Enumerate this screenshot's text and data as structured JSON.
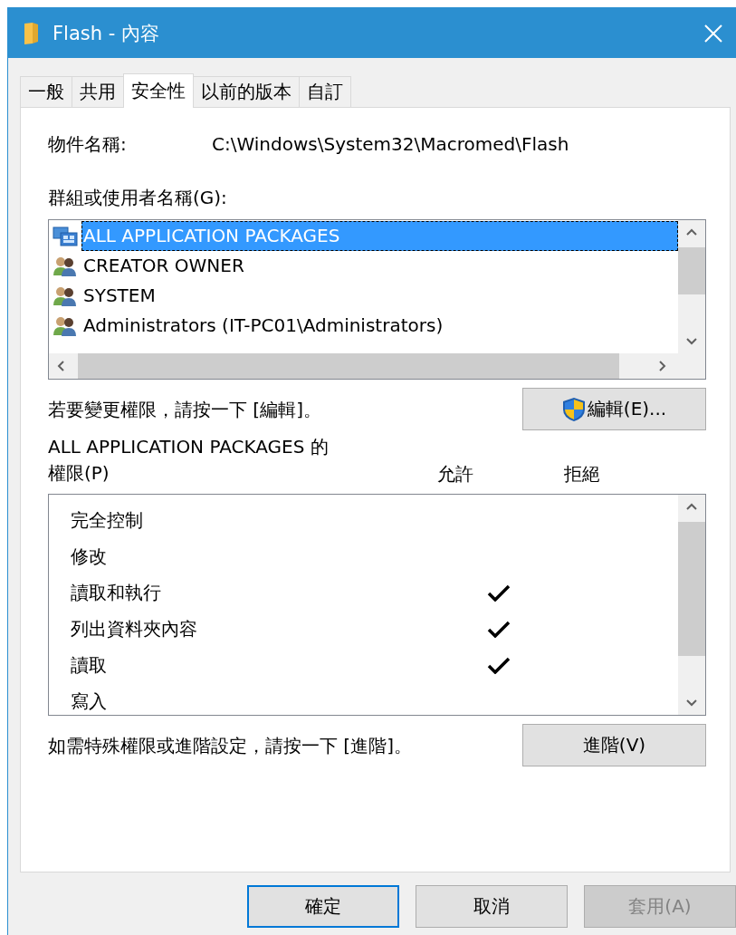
{
  "window": {
    "title": "Flash - 內容"
  },
  "tabs": [
    {
      "label": "一般",
      "selected": false
    },
    {
      "label": "共用",
      "selected": false
    },
    {
      "label": "安全性",
      "selected": true
    },
    {
      "label": "以前的版本",
      "selected": false
    },
    {
      "label": "自訂",
      "selected": false
    }
  ],
  "object_name": {
    "label": "物件名稱:",
    "value": "C:\\Windows\\System32\\Macromed\\Flash"
  },
  "groups_label": "群組或使用者名稱(G):",
  "groups": [
    {
      "name": "ALL APPLICATION PACKAGES",
      "kind": "package",
      "selected": true
    },
    {
      "name": "CREATOR OWNER",
      "kind": "users",
      "selected": false
    },
    {
      "name": "SYSTEM",
      "kind": "users",
      "selected": false
    },
    {
      "name": "Administrators (IT-PC01\\Administrators)",
      "kind": "users",
      "selected": false
    }
  ],
  "edit_hint": "若要變更權限，請按一下 [編輯]。",
  "edit_button": "編輯(E)...",
  "permissions_label": "ALL APPLICATION PACKAGES 的權限(P)",
  "columns": [
    "允許",
    "拒絕"
  ],
  "permissions": [
    {
      "name": "完全控制",
      "allow": false,
      "deny": false
    },
    {
      "name": "修改",
      "allow": false,
      "deny": false
    },
    {
      "name": "讀取和執行",
      "allow": true,
      "deny": false
    },
    {
      "name": "列出資料夾內容",
      "allow": true,
      "deny": false
    },
    {
      "name": "讀取",
      "allow": true,
      "deny": false
    },
    {
      "name": "寫入",
      "allow": false,
      "deny": false
    }
  ],
  "advanced_hint": "如需特殊權限或進階設定，請按一下 [進階]。",
  "advanced_button": "進階(V)",
  "buttons": [
    {
      "label": "確定",
      "default": true,
      "disabled": false
    },
    {
      "label": "取消",
      "default": false,
      "disabled": false
    },
    {
      "label": "套用(A)",
      "default": false,
      "disabled": true
    }
  ]
}
